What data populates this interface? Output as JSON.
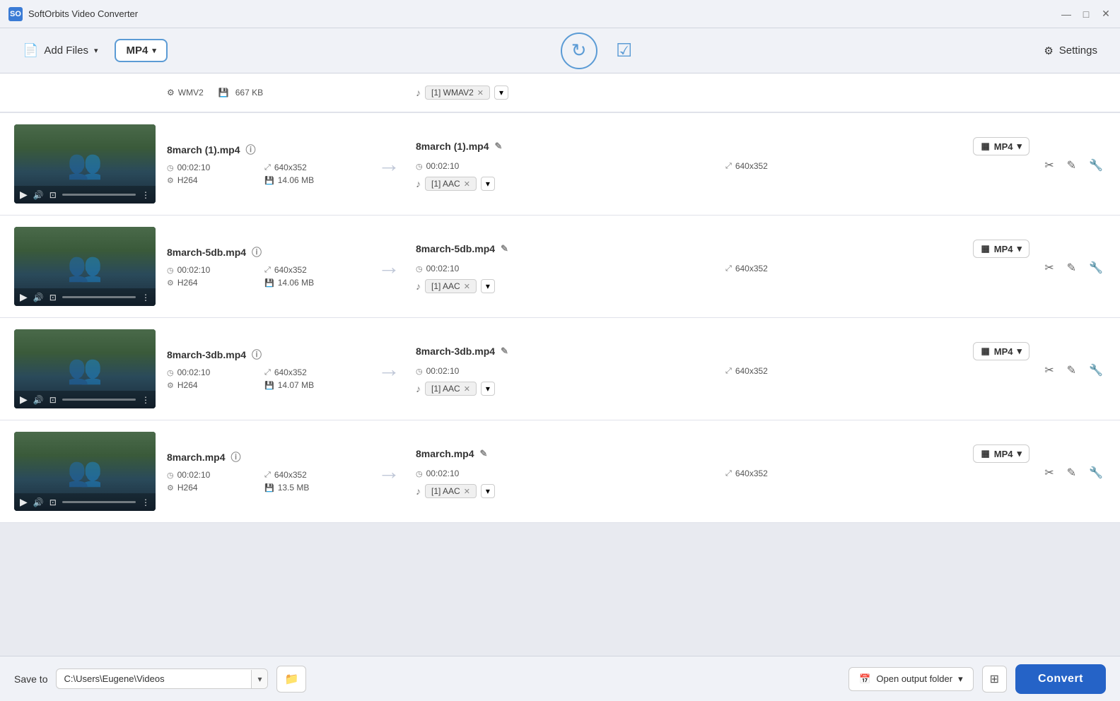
{
  "app": {
    "title": "SoftOrbits Video Converter",
    "icon": "SO"
  },
  "window_controls": {
    "minimize": "—",
    "maximize": "□",
    "close": "✕"
  },
  "toolbar": {
    "add_files_label": "Add Files",
    "format_label": "MP4",
    "rotate_icon": "↻",
    "check_icon": "✔",
    "settings_label": "Settings",
    "settings_icon": "⚙"
  },
  "partial_row": {
    "format_source": "WMV2",
    "file_size": "667 KB",
    "audio_label": "[1] WMAV2"
  },
  "video_rows": [
    {
      "id": "row1",
      "source_name": "8march (1).mp4",
      "duration": "00:02:10",
      "resolution": "640x352",
      "codec": "H264",
      "file_size": "14.06 MB",
      "output_name": "8march (1).mp4",
      "output_duration": "00:02:10",
      "output_resolution": "640x352",
      "output_format": "MP4",
      "audio_track": "[1] AAC"
    },
    {
      "id": "row2",
      "source_name": "8march-5db.mp4",
      "duration": "00:02:10",
      "resolution": "640x352",
      "codec": "H264",
      "file_size": "14.06 MB",
      "output_name": "8march-5db.mp4",
      "output_duration": "00:02:10",
      "output_resolution": "640x352",
      "output_format": "MP4",
      "audio_track": "[1] AAC"
    },
    {
      "id": "row3",
      "source_name": "8march-3db.mp4",
      "duration": "00:02:10",
      "resolution": "640x352",
      "codec": "H264",
      "file_size": "14.07 MB",
      "output_name": "8march-3db.mp4",
      "output_duration": "00:02:10",
      "output_resolution": "640x352",
      "output_format": "MP4",
      "audio_track": "[1] AAC"
    },
    {
      "id": "row4",
      "source_name": "8march.mp4",
      "duration": "00:02:10",
      "resolution": "640x352",
      "codec": "H264",
      "file_size": "13.5 MB",
      "output_name": "8march.mp4",
      "output_duration": "00:02:10",
      "output_resolution": "640x352",
      "output_format": "MP4",
      "audio_track": "[1] AAC"
    }
  ],
  "bottom_bar": {
    "save_to_label": "Save to",
    "save_path": "C:\\Users\\Eugene\\Videos",
    "open_folder_label": "Open output folder",
    "convert_label": "Convert",
    "dropdown_arrow": "▾",
    "folder_icon": "📁",
    "calendar_icon": "📅",
    "grid_icon": "⊞"
  },
  "icons": {
    "arrow_right": "→",
    "info": "ⓘ",
    "clock": "◷",
    "resize": "⤢",
    "gear": "⚙",
    "disk": "💾",
    "music": "♪",
    "edit": "✎",
    "scissors": "✂",
    "crop": "⊡",
    "wrench": "🔧",
    "grid": "▦",
    "chevron_down": "▾",
    "play": "▶",
    "volume": "🔊",
    "dots": "⋮"
  }
}
